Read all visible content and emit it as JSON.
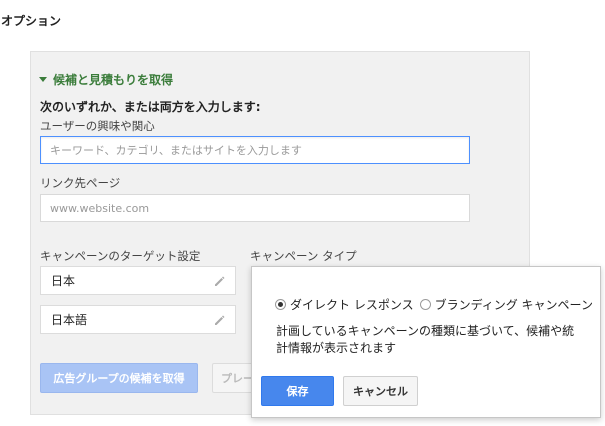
{
  "page_title": "オプション",
  "section": {
    "title": "候補と見積もりを取得",
    "prompt": "次のいずれか、または両方を入力します:"
  },
  "interests": {
    "label": "ユーザーの興味や関心",
    "placeholder": "キーワード、カテゴリ、またはサイトを入力します"
  },
  "landing_page": {
    "label": "リンク先ページ",
    "placeholder": "www.website.com"
  },
  "targeting": {
    "label": "キャンペーンのターゲット設定",
    "location": "日本",
    "language": "日本語"
  },
  "campaign_type": {
    "label": "キャンペーン タイプ",
    "options": [
      {
        "label": "ダイレクト レスポンス",
        "selected": true
      },
      {
        "label": "ブランディング キャンペーン",
        "selected": false
      }
    ],
    "description": "計画しているキャンペーンの種類に基づいて、候補や統計情報が表示されます",
    "save_label": "保存",
    "cancel_label": "キャンセル"
  },
  "actions": {
    "get_ideas_label": "広告グループの候補を取得",
    "preview_label": "プレー"
  },
  "colors": {
    "section_title": "#3b7d3b",
    "primary_button": "#4787ed",
    "focus_border": "#4d90fe"
  }
}
